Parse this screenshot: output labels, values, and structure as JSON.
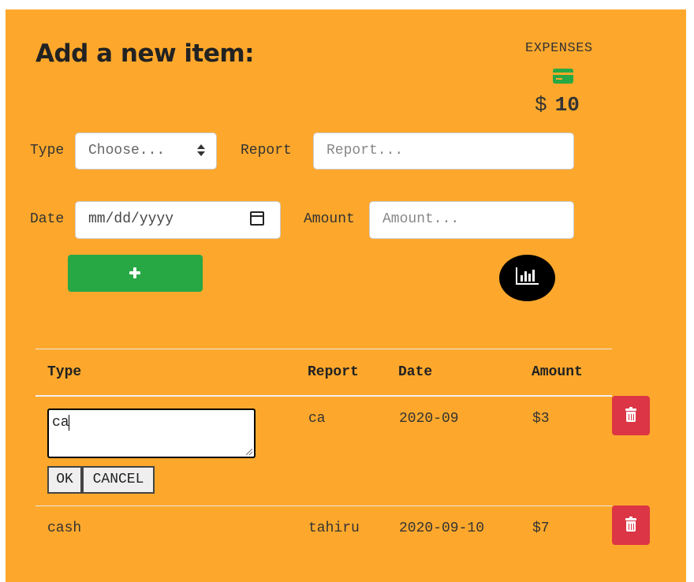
{
  "form": {
    "title": "Add a new item:",
    "type_label": "Type",
    "type_selected": "Choose...",
    "report_label": "Report",
    "report_placeholder": "Report...",
    "date_label": "Date",
    "date_placeholder": "mm/dd/yyyy",
    "amount_label": "Amount",
    "amount_placeholder": "Amount..."
  },
  "expenses": {
    "label": "EXPENSES",
    "currency": "$",
    "total": "10"
  },
  "colors": {
    "background": "#fda82c",
    "add_button": "#28a745",
    "delete_button": "#dc3545",
    "card_icon": "#27a844"
  },
  "table": {
    "headers": [
      "Type",
      "Report",
      "Date",
      "Amount"
    ],
    "rows": [
      {
        "type_edit_value": "ca",
        "report": "ca",
        "date": "2020-09",
        "amount": "$3"
      },
      {
        "type": "cash",
        "report": "tahiru",
        "date": "2020-09-10",
        "amount": "$7"
      }
    ],
    "ok_label": "OK",
    "cancel_label": "CANCEL"
  },
  "icons": {
    "add": "plus-icon",
    "chart": "bar-chart-icon",
    "card": "credit-card-icon",
    "delete": "trash-icon",
    "date": "calendar-icon"
  }
}
